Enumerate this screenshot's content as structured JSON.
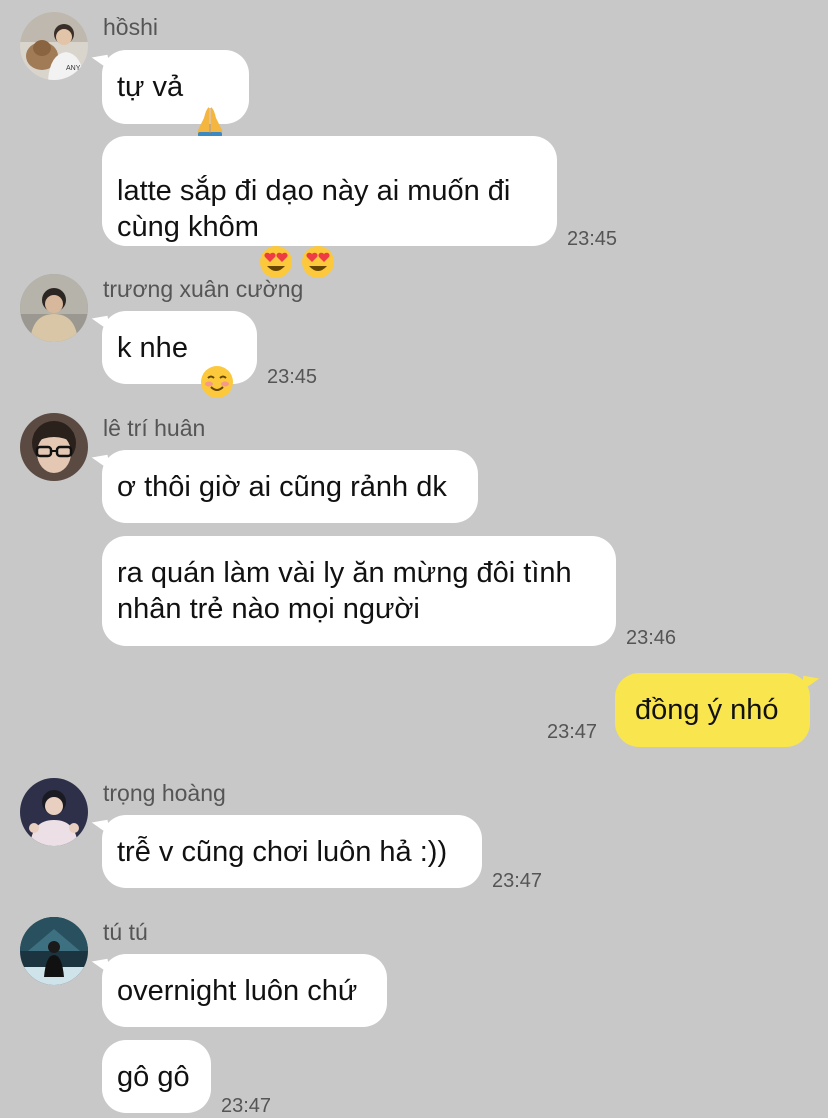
{
  "messages": [
    {
      "sender": "hồshi",
      "avatar_icon": "avatar-hoshi-icon",
      "bubbles": [
        {
          "text": "tự vả",
          "emoji": [
            "folded-hands-icon"
          ]
        },
        {
          "text": "latte sắp đi dạo này ai muốn đi\ncùng khôm",
          "emoji": [
            "heart-eyes-icon",
            "heart-eyes-icon"
          ],
          "time": "23:45"
        }
      ]
    },
    {
      "sender": "trương xuân cường",
      "avatar_icon": "avatar-cuong-icon",
      "bubbles": [
        {
          "text": "k nhe",
          "emoji": [
            "smiling-face-icon"
          ],
          "time": "23:45"
        }
      ]
    },
    {
      "sender": "lê trí huân",
      "avatar_icon": "avatar-huan-icon",
      "bubbles": [
        {
          "text": "ơ thôi giờ ai cũng rảnh dk"
        },
        {
          "text": "ra quán làm vài ly ăn mừng đôi tình\nnhân trẻ nào mọi người",
          "time": "23:46"
        }
      ]
    },
    {
      "sender": "me",
      "bubbles": [
        {
          "text": "đồng ý nhó",
          "time": "23:47"
        }
      ]
    },
    {
      "sender": "trọng hoàng",
      "avatar_icon": "avatar-hoang-icon",
      "bubbles": [
        {
          "text": "trễ v cũng chơi luôn hả :))",
          "time": "23:47"
        }
      ]
    },
    {
      "sender": "tú tú",
      "avatar_icon": "avatar-tu-icon",
      "bubbles": [
        {
          "text": "overnight luôn chứ"
        },
        {
          "text": "gô gô",
          "time": "23:47"
        }
      ]
    }
  ],
  "colors": {
    "background": "#c8c8c8",
    "bubble_other": "#ffffff",
    "bubble_mine": "#f9e54d",
    "meta_text": "#555555"
  }
}
